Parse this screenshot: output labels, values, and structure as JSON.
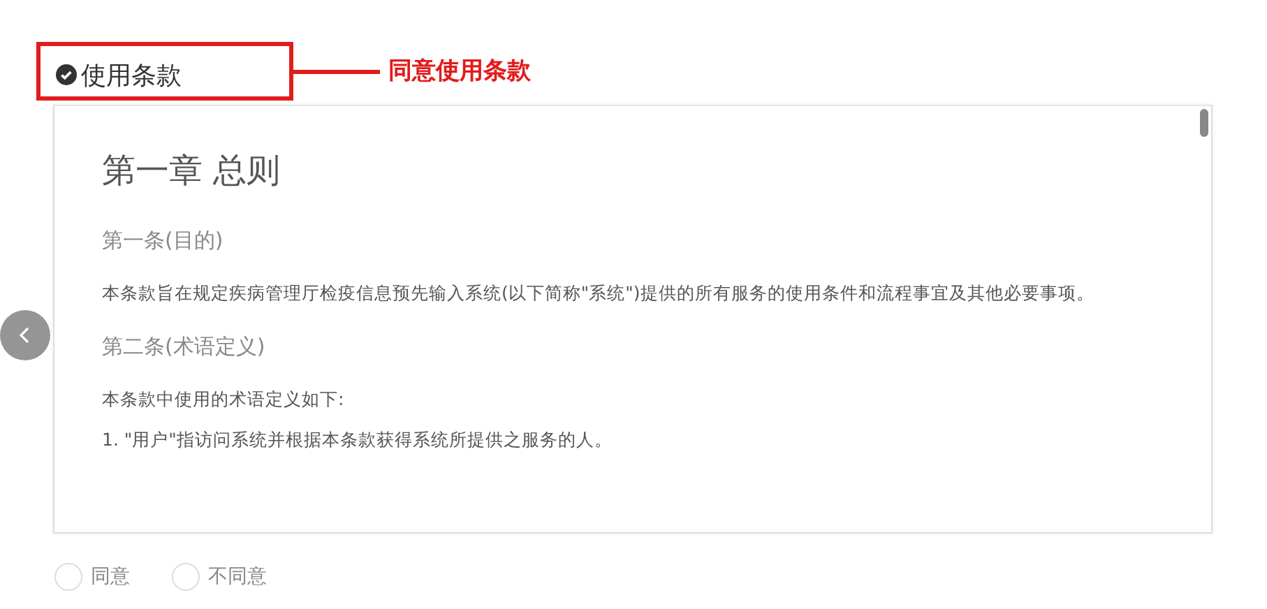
{
  "section": {
    "title": "使用条款",
    "checked": true
  },
  "annotation": {
    "label": "同意使用条款"
  },
  "terms": {
    "heading": "第一章 总则",
    "articles": [
      {
        "title": "第一条(目的)",
        "paragraphs": [
          "本条款旨在规定疾病管理厅检疫信息预先输入系统(以下简称\"系统\")提供的所有服务的使用条件和流程事宜及其他必要事项。"
        ]
      },
      {
        "title": "第二条(术语定义)",
        "paragraphs": [
          "本条款中使用的术语定义如下:",
          "1. \"用户\"指访问系统并根据本条款获得系统所提供之服务的人。"
        ]
      }
    ]
  },
  "options": [
    {
      "label": "同意",
      "selected": false
    },
    {
      "label": "不同意",
      "selected": false
    }
  ]
}
